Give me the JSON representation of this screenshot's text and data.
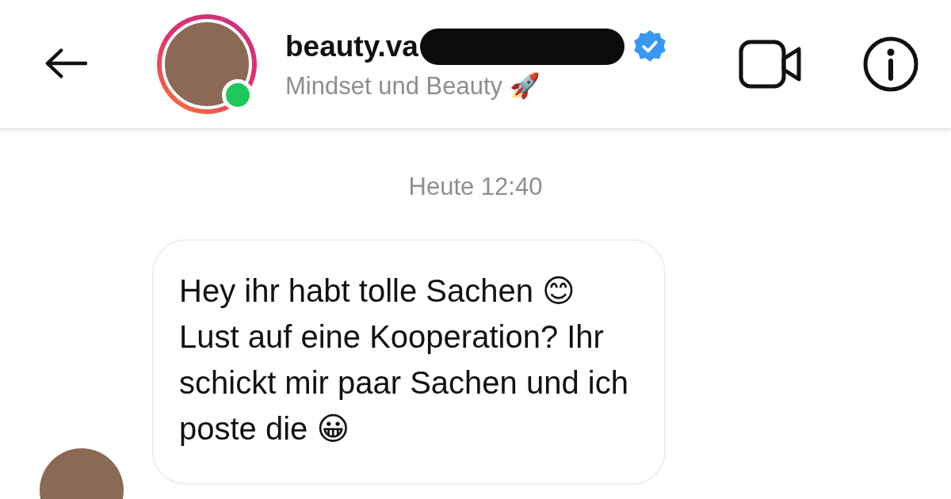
{
  "header": {
    "name": "beauty.va",
    "verified": true,
    "online": true,
    "subtitle": "Mindset und Beauty 🚀"
  },
  "timestamp": "Heute 12:40",
  "messages": [
    {
      "kind": "incoming",
      "text": "Hey ihr habt tolle Sachen 😊 Lust auf eine Kooperation? Ihr schickt mir paar Sachen und ich poste die 😀"
    }
  ]
}
